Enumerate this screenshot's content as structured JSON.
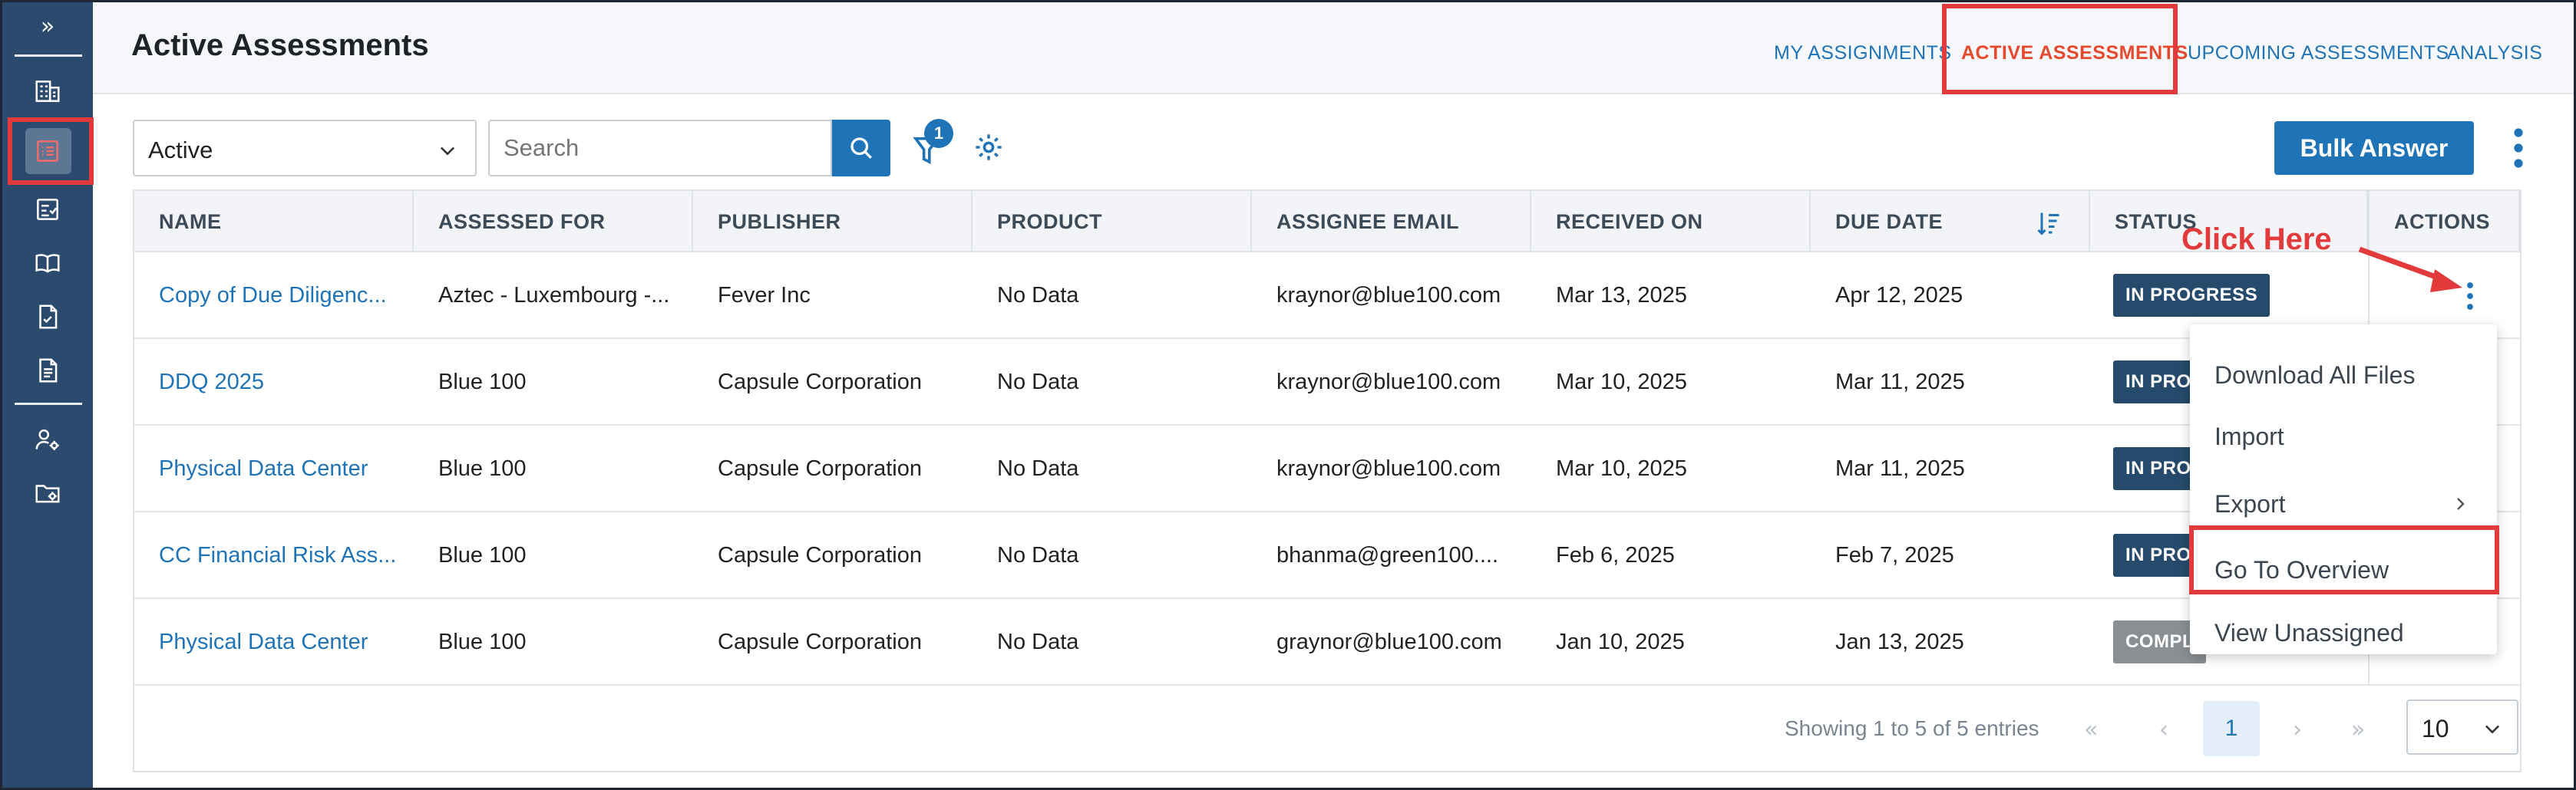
{
  "header": {
    "title": "Active Assessments",
    "tabs": [
      {
        "label": "MY ASSIGNMENTS"
      },
      {
        "label": "ACTIVE ASSESSMENTS"
      },
      {
        "label": "UPCOMING ASSESSMENTS"
      },
      {
        "label": "ANALYSIS"
      }
    ]
  },
  "sidebar": {
    "expand_glyph": "»",
    "icons": [
      "building-icon",
      "list-icon",
      "checklist-icon",
      "book-icon",
      "document-check-icon",
      "document-icon",
      "user-gear-icon",
      "folder-gear-icon"
    ]
  },
  "toolbar": {
    "status_select": "Active",
    "search_placeholder": "Search",
    "filter_count": "1",
    "bulk_label": "Bulk Answer"
  },
  "table": {
    "columns": [
      "NAME",
      "ASSESSED FOR",
      "PUBLISHER",
      "PRODUCT",
      "ASSIGNEE EMAIL",
      "RECEIVED ON",
      "DUE DATE",
      "STATUS",
      "ACTIONS"
    ],
    "rows": [
      {
        "name": "Copy of Due Diligenc...",
        "assessed_for": "Aztec - Luxembourg -...",
        "publisher": "Fever Inc",
        "product": "No Data",
        "email": "kraynor@blue100.com",
        "received": "Mar 13, 2025",
        "due": "Apr 12, 2025",
        "status": "IN PROGRESS"
      },
      {
        "name": "DDQ 2025",
        "assessed_for": "Blue 100",
        "publisher": "Capsule Corporation",
        "product": "No Data",
        "email": "kraynor@blue100.com",
        "received": "Mar 10, 2025",
        "due": "Mar 11, 2025",
        "status": "IN PROG"
      },
      {
        "name": "Physical Data Center",
        "assessed_for": "Blue 100",
        "publisher": "Capsule Corporation",
        "product": "No Data",
        "email": "kraynor@blue100.com",
        "received": "Mar 10, 2025",
        "due": "Mar 11, 2025",
        "status": "IN PROG"
      },
      {
        "name": "CC Financial Risk Ass...",
        "assessed_for": "Blue 100",
        "publisher": "Capsule Corporation",
        "product": "No Data",
        "email": "bhanma@green100....",
        "received": "Feb 6, 2025",
        "due": "Feb 7, 2025",
        "status": "IN PRO"
      },
      {
        "name": "Physical Data Center",
        "assessed_for": "Blue 100",
        "publisher": "Capsule Corporation",
        "product": "No Data",
        "email": "graynor@blue100.com",
        "received": "Jan 10, 2025",
        "due": "Jan 13, 2025",
        "status": "COMPL"
      }
    ]
  },
  "pagination": {
    "showing": "Showing 1 to 5 of 5 entries",
    "current_page": "1",
    "page_size": "10",
    "first": "«",
    "prev": "‹",
    "next": "›",
    "last": "»"
  },
  "annotation": {
    "click_here": "Click Here"
  },
  "menu": {
    "items": [
      "Download All Files",
      "Import",
      "Export",
      "Go To Overview",
      "View Unassigned"
    ]
  },
  "colors": {
    "sidebar": "#2b4a6d",
    "primary": "#1f73b7",
    "highlight": "#e33b3b",
    "active_tab": "#e64a2e"
  }
}
